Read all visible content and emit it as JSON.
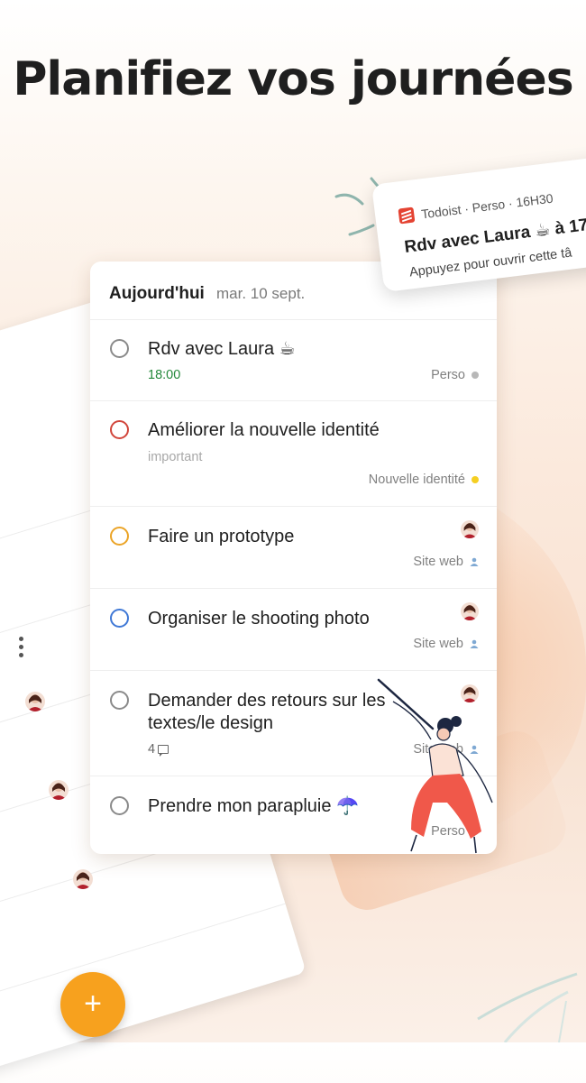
{
  "headline": "Planifiez vos journées",
  "header": {
    "title": "Aujourd'hui",
    "date": "mar. 10 sept."
  },
  "tasks": [
    {
      "title": "Rdv avec Laura ☕",
      "time": "18:00",
      "project": "Perso",
      "priority_color": "#8a8a8a",
      "project_color": "#b8b8b8"
    },
    {
      "title": "Améliorer la nouvelle identité",
      "label": "important",
      "project": "Nouvelle identité",
      "priority_color": "#d1453b",
      "project_color": "#f5cf22"
    },
    {
      "title": "Faire un prototype",
      "project": "Site web",
      "priority_color": "#eba427",
      "shared": true
    },
    {
      "title": "Organiser le shooting photo",
      "project": "Site web",
      "priority_color": "#3f78d6",
      "shared": true
    },
    {
      "title_line1": "Demander des retours sur les",
      "title_line2": "textes/le design",
      "comments": "4",
      "project": "Site web",
      "priority_color": "#8a8a8a",
      "shared": true
    },
    {
      "title": "Prendre mon parapluie ☂️",
      "project": "Perso",
      "priority_color": "#8a8a8a"
    }
  ],
  "notification": {
    "app": "Todoist · Perso · 16H30",
    "title": "Rdv avec Laura ☕ à 17",
    "body": "Appuyez pour ouvrir cette tâ"
  },
  "fab": {
    "label": "+"
  },
  "icons": {
    "notification_app": "todoist-logo-icon",
    "shared": "person-icon",
    "comments": "comment-icon",
    "more": "more-vertical-icon"
  },
  "colors": {
    "accent": "#f7a11e",
    "time": "#23883a",
    "muted": "#808080"
  }
}
